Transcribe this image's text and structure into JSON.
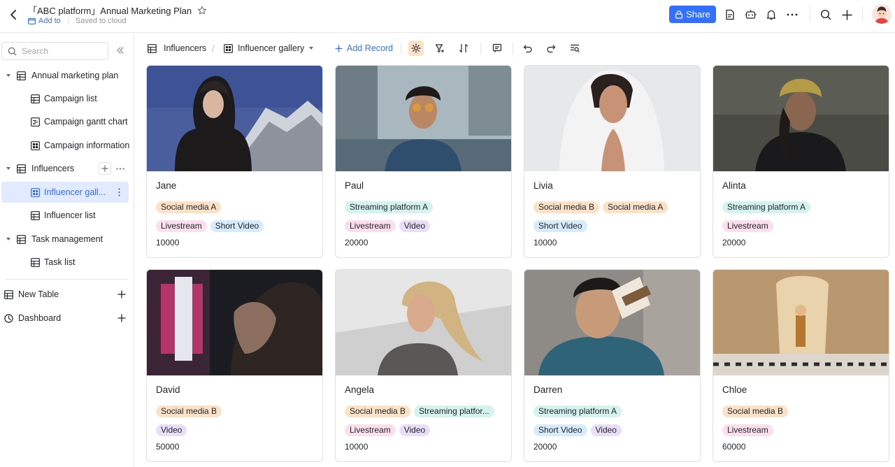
{
  "header": {
    "title": "「ABC platform」Annual Marketing Plan",
    "add_to": "Add to",
    "saved": "Saved to cloud",
    "share": "Share",
    "icons": [
      "page-icon",
      "bot-icon",
      "bell-icon",
      "more-icon",
      "search-icon",
      "plus-icon"
    ]
  },
  "sidebar": {
    "search_placeholder": "Search",
    "groups": [
      {
        "label": "Annual marketing plan",
        "children": [
          "Campaign list",
          "Campaign gantt chart",
          "Campaign information"
        ]
      },
      {
        "label": "Influencers",
        "children": [
          "Influencer gall...",
          "Influencer list"
        ]
      },
      {
        "label": "Task management",
        "children": [
          "Task list"
        ]
      }
    ],
    "new_table": "New Table",
    "dashboard": "Dashboard"
  },
  "toolbar": {
    "table_name": "Influencers",
    "view_name": "Influencer gallery",
    "add_record": "Add Record"
  },
  "colors": {
    "accent": "#3370ff",
    "active_bg": "#e1eaff"
  },
  "cards": [
    {
      "name": "Jane",
      "row1": [
        [
          "Social media A",
          "orange"
        ]
      ],
      "row2": [
        [
          "Livestream",
          "pink"
        ],
        [
          "Short Video",
          "blue"
        ]
      ],
      "count": "10000"
    },
    {
      "name": "Paul",
      "row1": [
        [
          "Streaming platform A",
          "teal"
        ]
      ],
      "row2": [
        [
          "Livestream",
          "pink"
        ],
        [
          "Video",
          "purple"
        ]
      ],
      "count": "20000"
    },
    {
      "name": "Livia",
      "row1": [
        [
          "Social media B",
          "orange"
        ],
        [
          "Social media A",
          "orange"
        ]
      ],
      "row2": [
        [
          "Short Video",
          "blue"
        ]
      ],
      "count": "10000"
    },
    {
      "name": "Alinta",
      "row1": [
        [
          "Streaming platform A",
          "teal"
        ]
      ],
      "row2": [
        [
          "Livestream",
          "pink"
        ]
      ],
      "count": "20000"
    },
    {
      "name": "David",
      "row1": [
        [
          "Social media B",
          "orange"
        ]
      ],
      "row2": [
        [
          "Video",
          "purple"
        ]
      ],
      "count": "50000"
    },
    {
      "name": "Angela",
      "row1": [
        [
          "Social media B",
          "orange"
        ],
        [
          "Streaming platfor...",
          "teal"
        ]
      ],
      "row2": [
        [
          "Livestream",
          "pink"
        ],
        [
          "Video",
          "purple"
        ]
      ],
      "count": "10000"
    },
    {
      "name": "Darren",
      "row1": [
        [
          "Streaming platform A",
          "teal"
        ]
      ],
      "row2": [
        [
          "Short Video",
          "blue"
        ],
        [
          "Video",
          "purple"
        ]
      ],
      "count": "20000"
    },
    {
      "name": "Chloe",
      "row1": [
        [
          "Social media B",
          "orange"
        ]
      ],
      "row2": [
        [
          "Livestream",
          "pink"
        ]
      ],
      "count": "60000"
    }
  ]
}
